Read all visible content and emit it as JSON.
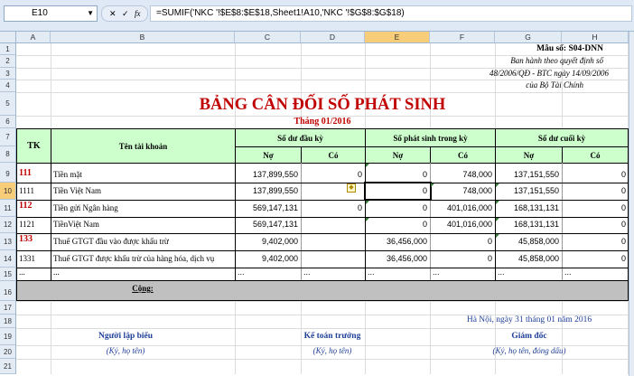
{
  "formula_bar": {
    "cell_ref": "E10",
    "fx_label": "fx",
    "formula": "=SUMIF('NKC '!$E$8:$E$18,Sheet1!A10,'NKC '!$G$8:$G$18)"
  },
  "columns": [
    "A",
    "B",
    "C",
    "D",
    "E",
    "F",
    "G",
    "H"
  ],
  "rows": [
    "1",
    "2",
    "3",
    "4",
    "5",
    "6",
    "7",
    "8",
    "9",
    "10",
    "11",
    "12",
    "13",
    "14",
    "15",
    "16",
    "17",
    "18",
    "19",
    "20",
    "21"
  ],
  "header_info": {
    "form_no": "Mẫu số: S04-DNN",
    "issued": "Ban hành theo quyết định số",
    "decision": "48/2006/QĐ - BTC ngày 14/09/2006",
    "ministry": "của Bộ Tài Chính"
  },
  "report": {
    "title": "BẢNG CÂN ĐỐI SỐ PHÁT SINH",
    "period": "Tháng 01/2016"
  },
  "table_header": {
    "tk": "TK",
    "account_name": "Tên tài khoản",
    "opening": "Số dư đầu kỳ",
    "movement": "Số phát sinh trong kỳ",
    "closing": "Số dư cuối kỳ",
    "debit": "Nợ",
    "credit": "Có"
  },
  "table_rows": [
    {
      "tk": "111",
      "name": "Tiền mặt",
      "c": "137,899,550",
      "d": "0",
      "e": "0",
      "f": "748,000",
      "g": "137,151,550",
      "h": "0"
    },
    {
      "tk": "1111",
      "name": "Tiền Việt Nam",
      "c": "137,899,550",
      "d": "",
      "e": "0",
      "f": "748,000",
      "g": "137,151,550",
      "h": "0"
    },
    {
      "tk": "112",
      "name": "Tiền gửi Ngân hàng",
      "c": "569,147,131",
      "d": "0",
      "e": "0",
      "f": "401,016,000",
      "g": "168,131,131",
      "h": "0"
    },
    {
      "tk": "1121",
      "name": "TiềnViệt Nam",
      "c": "569,147,131",
      "d": "",
      "e": "0",
      "f": "401,016,000",
      "g": "168,131,131",
      "h": "0"
    },
    {
      "tk": "133",
      "name": "Thuế GTGT đầu vào được khấu trừ",
      "c": "9,402,000",
      "d": "",
      "e": "36,456,000",
      "f": "0",
      "g": "45,858,000",
      "h": "0"
    },
    {
      "tk": "1331",
      "name": "Thuế GTGT được khấu trừ của hàng hóa, dịch vụ",
      "c": "9,402,000",
      "d": "",
      "e": "36,456,000",
      "f": "0",
      "g": "45,858,000",
      "h": "0"
    },
    {
      "tk": "...",
      "name": "...",
      "c": "...",
      "d": "...",
      "e": "...",
      "f": "...",
      "g": "...",
      "h": "..."
    }
  ],
  "total_label": "Cộng:",
  "footer": {
    "place_date": "Hà Nội, ngày 31 tháng 01 năm 2016",
    "preparer": "Người lập biểu",
    "accountant": "Kế toán trưởng",
    "director": "Giám đốc",
    "sign_name": "(Ký, họ tên)",
    "sign_name2": "(Ký, họ tên)",
    "sign_stamp": "(Ký, họ tên, đóng dấu)"
  }
}
